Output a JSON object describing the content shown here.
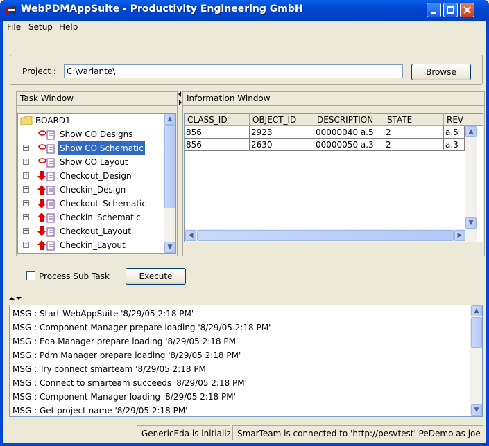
{
  "window": {
    "title": "WebPDMAppSuite - Productivity Engineering GmbH"
  },
  "menu": {
    "file": "File",
    "setup": "Setup",
    "help": "Help"
  },
  "project": {
    "label": "Project :",
    "value": "C:\\variante\\",
    "browse_label": "Browse"
  },
  "task_window": {
    "title": "Task Window",
    "root": "BOARD1",
    "items": [
      {
        "label": "Show CO Designs",
        "icon": "design-link-icon",
        "expandable": false
      },
      {
        "label": "Show CO Schematic",
        "icon": "design-link-icon",
        "expandable": true,
        "selected": true
      },
      {
        "label": "Show CO Layout",
        "icon": "design-link-icon",
        "expandable": true
      },
      {
        "label": "Checkout_Design",
        "icon": "checkout-arrow-icon",
        "expandable": true
      },
      {
        "label": "Checkin_Design",
        "icon": "checkin-arrow-icon",
        "expandable": true
      },
      {
        "label": "Checkout_Schematic",
        "icon": "checkout-arrow-icon",
        "expandable": true
      },
      {
        "label": "Checkin_Schematic",
        "icon": "checkin-arrow-icon",
        "expandable": true
      },
      {
        "label": "Checkout_Layout",
        "icon": "checkout-arrow-icon",
        "expandable": true
      },
      {
        "label": "Checkin_Layout",
        "icon": "checkin-arrow-icon",
        "expandable": true
      }
    ]
  },
  "info_window": {
    "title": "Information Window",
    "columns": [
      "CLASS_ID",
      "OBJECT_ID",
      "DESCRIPTION",
      "STATE",
      "REV"
    ],
    "rows": [
      [
        "856",
        "2923",
        "00000040 a.5",
        "2",
        "a.5"
      ],
      [
        "856",
        "2630",
        "00000050 a.3",
        "2",
        "a.3"
      ]
    ]
  },
  "process_sub_task": {
    "label": "Process Sub Task",
    "checked": false
  },
  "execute_label": "Execute",
  "log": {
    "lines": [
      "MSG : Start WebAppSuite '8/29/05 2:18 PM'",
      "MSG : Component Manager prepare loading '8/29/05 2:18 PM'",
      "MSG : Eda Manager prepare loading '8/29/05 2:18 PM'",
      "MSG : Pdm Manager prepare loading '8/29/05 2:18 PM'",
      "MSG : Try connect smarteam '8/29/05 2:18 PM'",
      "MSG : Connect to smarteam succeeds '8/29/05 2:18 PM'",
      "MSG : Component Manager loading '8/29/05 2:18 PM'",
      "MSG : Get project name '8/29/05 2:18 PM'"
    ]
  },
  "status": {
    "eda": "GenericEda is initialized",
    "smarteam": "SmarTeam is connected to 'http://pesvtest' PeDemo as joe"
  },
  "colors": {
    "selection": "#316ac5",
    "titlebar": "#0047d4",
    "checkout_arrow": "#e00000"
  }
}
